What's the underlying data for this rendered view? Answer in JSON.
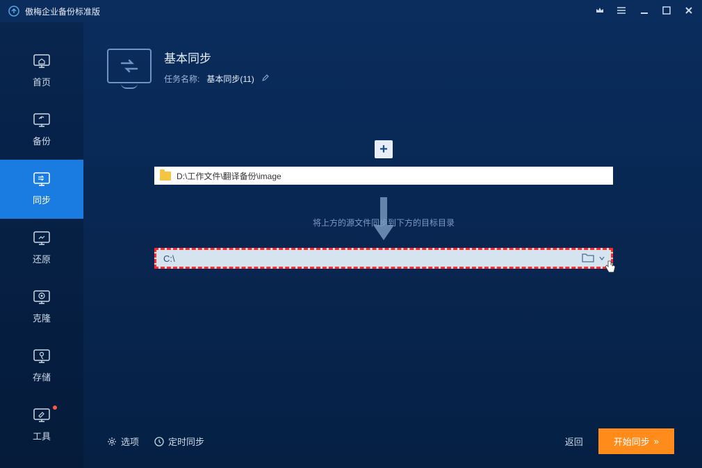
{
  "app_title": "傲梅企业备份标准版",
  "sidebar": {
    "items": [
      {
        "label": "首页"
      },
      {
        "label": "备份"
      },
      {
        "label": "同步"
      },
      {
        "label": "还原"
      },
      {
        "label": "克隆"
      },
      {
        "label": "存储"
      },
      {
        "label": "工具"
      }
    ]
  },
  "header": {
    "title": "基本同步",
    "task_label": "任务名称:",
    "task_name": "基本同步(11)"
  },
  "source_path": "D:\\工作文件\\翻译备份\\image",
  "hint": "将上方的源文件同步到下方的目标目录",
  "dest_path": "C:\\",
  "bottom": {
    "options": "选项",
    "schedule": "定时同步",
    "back": "返回",
    "start": "开始同步"
  }
}
